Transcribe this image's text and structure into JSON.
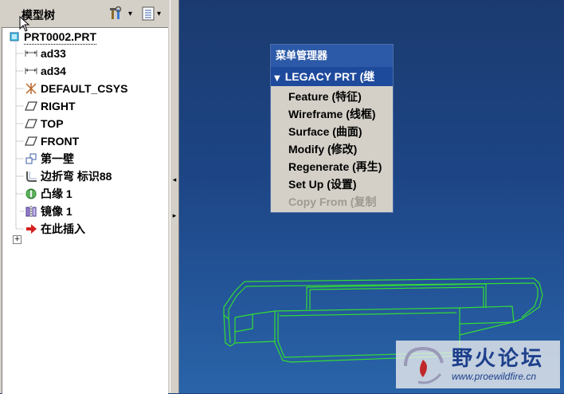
{
  "tree": {
    "title": "模型树",
    "items": [
      {
        "label": "PRT0002.PRT",
        "icon": "part-icon"
      },
      {
        "label": "ad33",
        "icon": "dimension-icon"
      },
      {
        "label": "ad34",
        "icon": "dimension-icon"
      },
      {
        "label": "DEFAULT_CSYS",
        "icon": "csys-icon"
      },
      {
        "label": "RIGHT",
        "icon": "datum-plane-icon"
      },
      {
        "label": "TOP",
        "icon": "datum-plane-icon"
      },
      {
        "label": "FRONT",
        "icon": "datum-plane-icon"
      },
      {
        "label": "第一壁",
        "icon": "first-wall-icon"
      },
      {
        "label": "边折弯 标识88",
        "icon": "edge-bend-icon"
      },
      {
        "label": "凸缘 1",
        "icon": "flange-icon"
      },
      {
        "label": "镜像 1",
        "icon": "mirror-icon"
      },
      {
        "label": "在此插入",
        "icon": "insert-arrow-icon"
      }
    ]
  },
  "menu": {
    "title": "菜单管理器",
    "header": "LEGACY PRT (继",
    "items": [
      {
        "label": "Feature (特征)",
        "enabled": true
      },
      {
        "label": "Wireframe (线框)",
        "enabled": true
      },
      {
        "label": "Surface (曲面)",
        "enabled": true
      },
      {
        "label": "Modify (修改)",
        "enabled": true
      },
      {
        "label": "Regenerate (再生)",
        "enabled": true
      },
      {
        "label": "Set Up (设置)",
        "enabled": true
      },
      {
        "label": "Copy From (复制",
        "enabled": false
      }
    ]
  },
  "watermark": {
    "title": "野火论坛",
    "url": "www.proewildfire.cn"
  },
  "colors": {
    "background_top": "#1b3b70",
    "background_bottom": "#2a64a8",
    "model_edges": "#33dd33",
    "menu_title": "#2c5aa8",
    "menu_header": "#1e4a9c"
  }
}
